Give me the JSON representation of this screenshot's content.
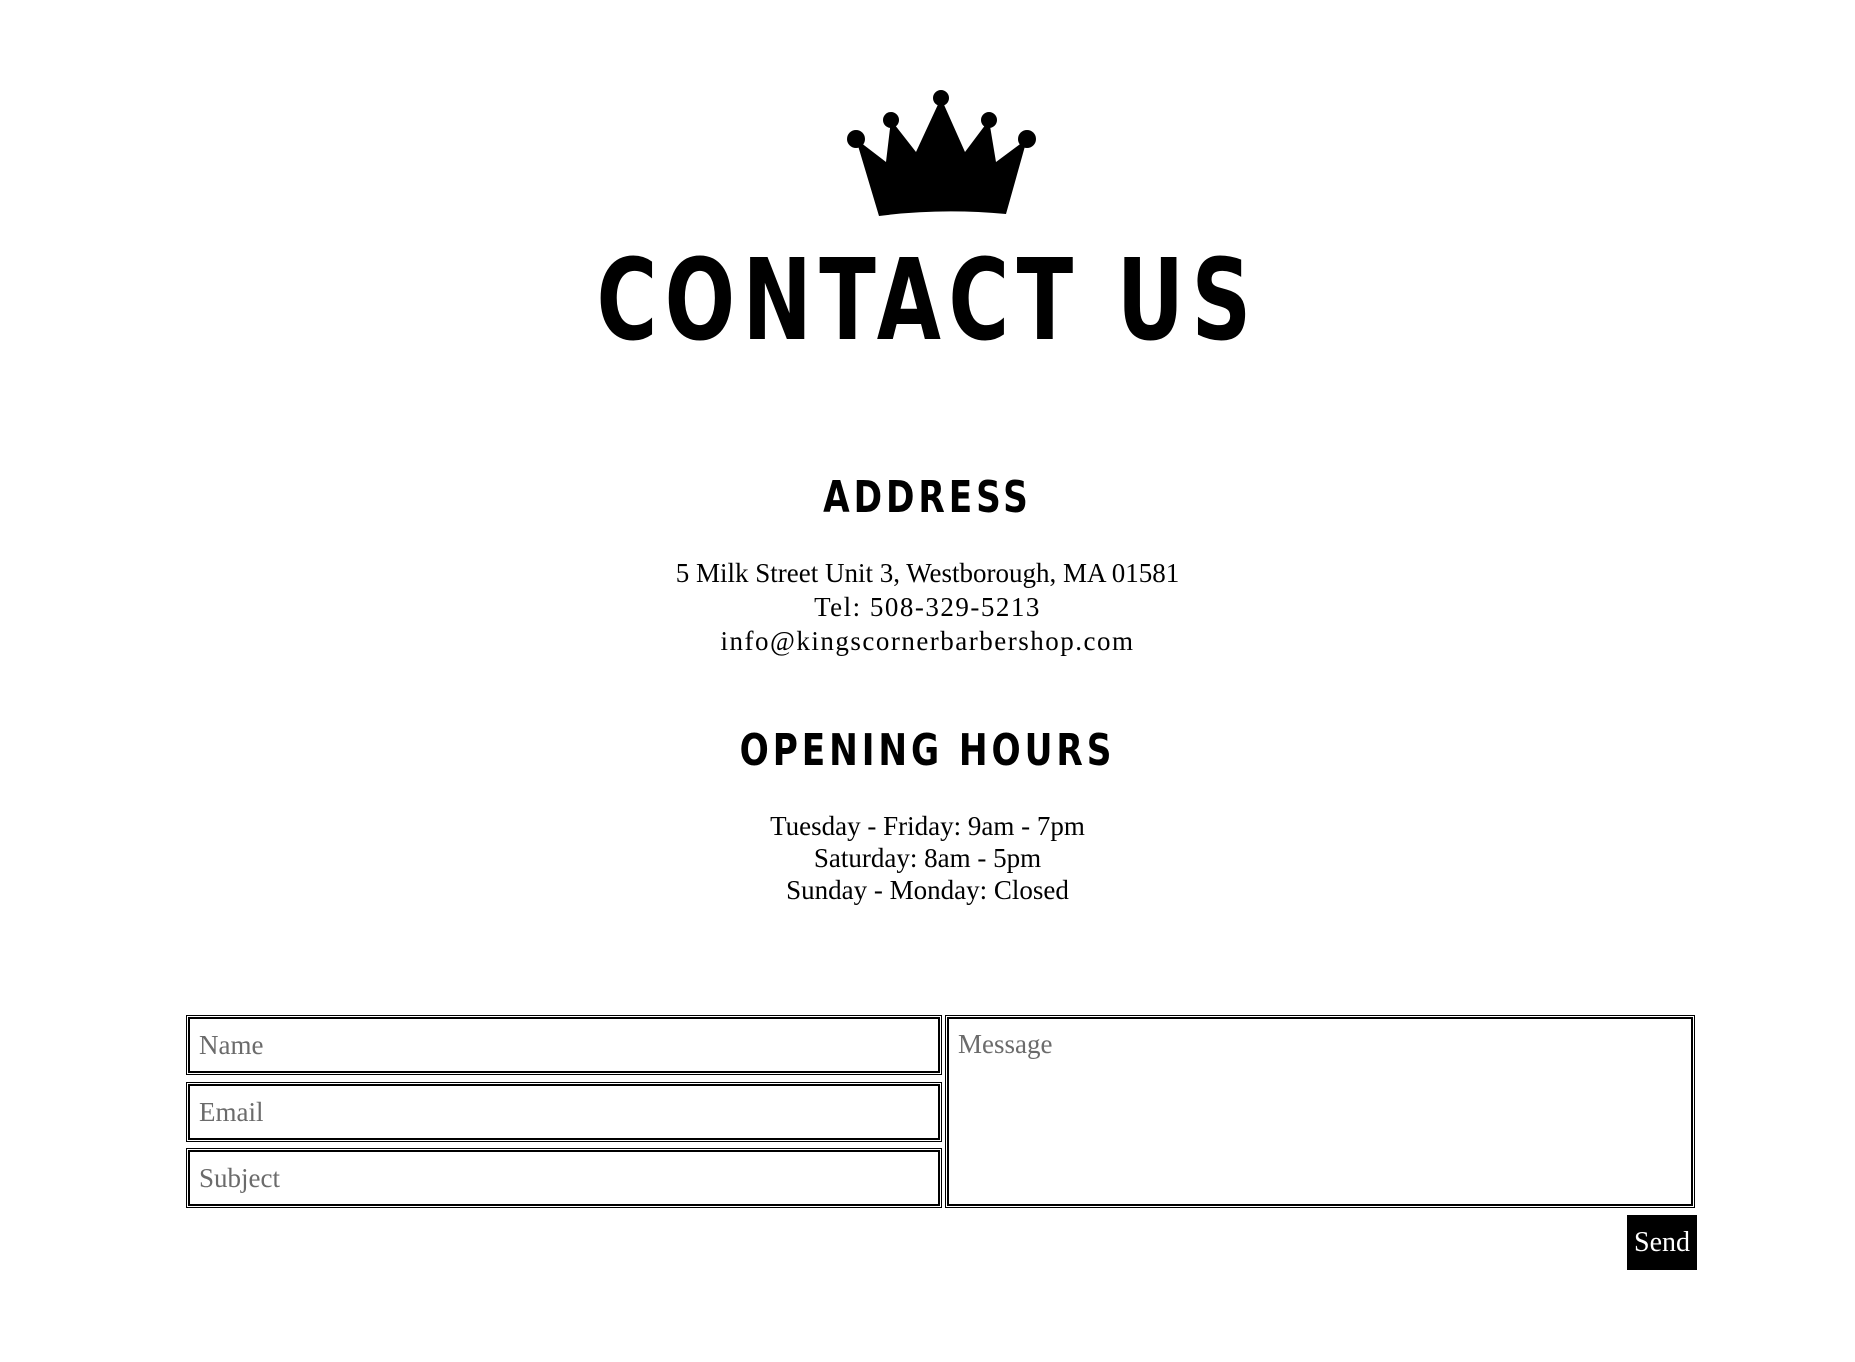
{
  "header": {
    "logo_icon": "crown-icon",
    "title": "CONTACT US"
  },
  "address": {
    "heading": "ADDRESS",
    "street": "5 Milk Street Unit 3, Westborough, MA 01581",
    "phone": "Tel: 508-329-5213",
    "email": "info@kingscornerbarbershop.com"
  },
  "hours": {
    "heading": "OPENING HOURS",
    "lines": [
      "Tuesday - Friday: 9am - 7pm",
      "Saturday: 8am - 5pm",
      "Sunday - Monday: Closed"
    ]
  },
  "form": {
    "name_placeholder": "Name",
    "name_value": "",
    "email_placeholder": "Email",
    "email_value": "",
    "subject_placeholder": "Subject",
    "subject_value": "",
    "message_placeholder": "Message",
    "message_value": "",
    "send_label": "Send"
  },
  "colors": {
    "text": "#000000",
    "background": "#ffffff",
    "button_bg": "#000000",
    "button_text": "#ffffff",
    "placeholder": "#6b6b6b"
  }
}
